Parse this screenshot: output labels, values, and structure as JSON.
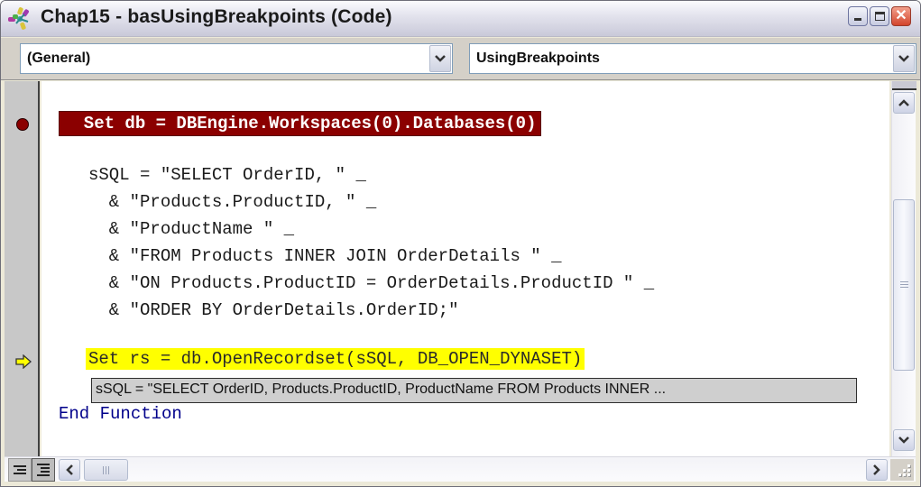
{
  "window": {
    "title": "Chap15 - basUsingBreakpoints (Code)",
    "icon": "vba-project-icon",
    "controls": [
      "minimize",
      "maximize",
      "close"
    ]
  },
  "combos": {
    "object": {
      "value": "(General)"
    },
    "procedure": {
      "value": "UsingBreakpoints"
    }
  },
  "code": {
    "breakpoint_line": "  Set db = DBEngine.Workspaces(0).Databases(0)",
    "lines": [
      "sSQL = \"SELECT OrderID, \" _",
      "  & \"Products.ProductID, \" _",
      "  & \"ProductName \" _",
      "  & \"FROM Products INNER JOIN OrderDetails \" _",
      "  & \"ON Products.ProductID = OrderDetails.ProductID \" _",
      "  & \"ORDER BY OrderDetails.OrderID;\""
    ],
    "execution_line": "Set rs = db.OpenRecordset(sSQL, DB_OPEN_DYNASET)",
    "end_line": "End Function"
  },
  "datatip": {
    "text": "sSQL = \"SELECT OrderID, Products.ProductID, ProductName FROM Products INNER ..."
  },
  "colors": {
    "breakpoint": "#8b0000",
    "execution_highlight": "#ffff00",
    "keyword": "#00008b"
  }
}
